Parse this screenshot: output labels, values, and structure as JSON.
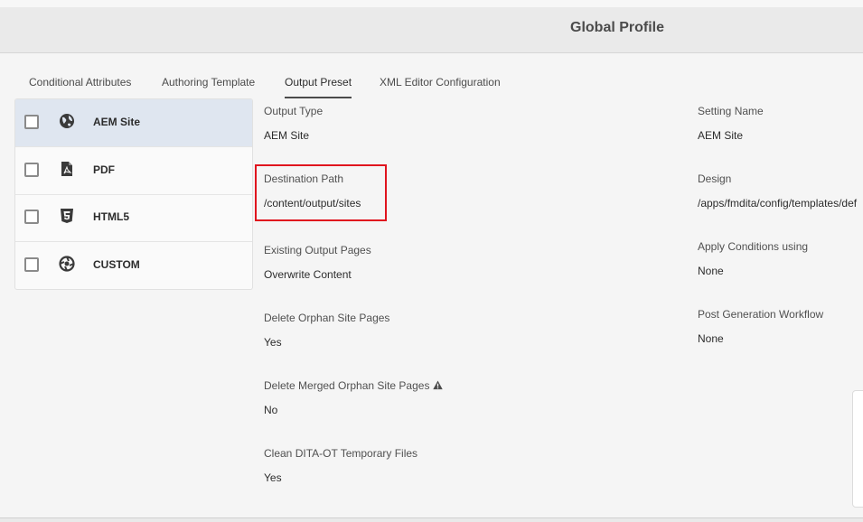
{
  "header": {
    "title": "Global Profile"
  },
  "tabs": [
    {
      "label": "Conditional Attributes",
      "active": false
    },
    {
      "label": "Authoring Template",
      "active": false
    },
    {
      "label": "Output Preset",
      "active": true
    },
    {
      "label": "XML Editor Configuration",
      "active": false
    }
  ],
  "presets": [
    {
      "label": "AEM Site",
      "icon": "globe-icon",
      "selected": true
    },
    {
      "label": "PDF",
      "icon": "pdf-icon",
      "selected": false
    },
    {
      "label": "HTML5",
      "icon": "html5-icon",
      "selected": false
    },
    {
      "label": "CUSTOM",
      "icon": "custom-icon",
      "selected": false
    }
  ],
  "left_fields": [
    {
      "label": "Output Type",
      "value": "AEM Site"
    },
    {
      "label": "Destination Path",
      "value": "/content/output/sites"
    },
    {
      "label": "Existing Output Pages",
      "value": "Overwrite Content"
    },
    {
      "label": "Delete Orphan Site Pages",
      "value": "Yes"
    },
    {
      "label": "Delete Merged Orphan Site Pages",
      "value": "No",
      "icon": "warning-icon"
    },
    {
      "label": "Clean DITA-OT Temporary Files",
      "value": "Yes"
    }
  ],
  "right_fields": [
    {
      "label": "Setting Name",
      "value": "AEM Site"
    },
    {
      "label": "Design",
      "value": "/apps/fmdita/config/templates/def"
    },
    {
      "label": "Apply Conditions using",
      "value": "None"
    },
    {
      "label": "Post Generation Workflow",
      "value": "None"
    }
  ],
  "colors": {
    "highlight": "#e0141e",
    "selected_row": "#dfe6f0"
  }
}
